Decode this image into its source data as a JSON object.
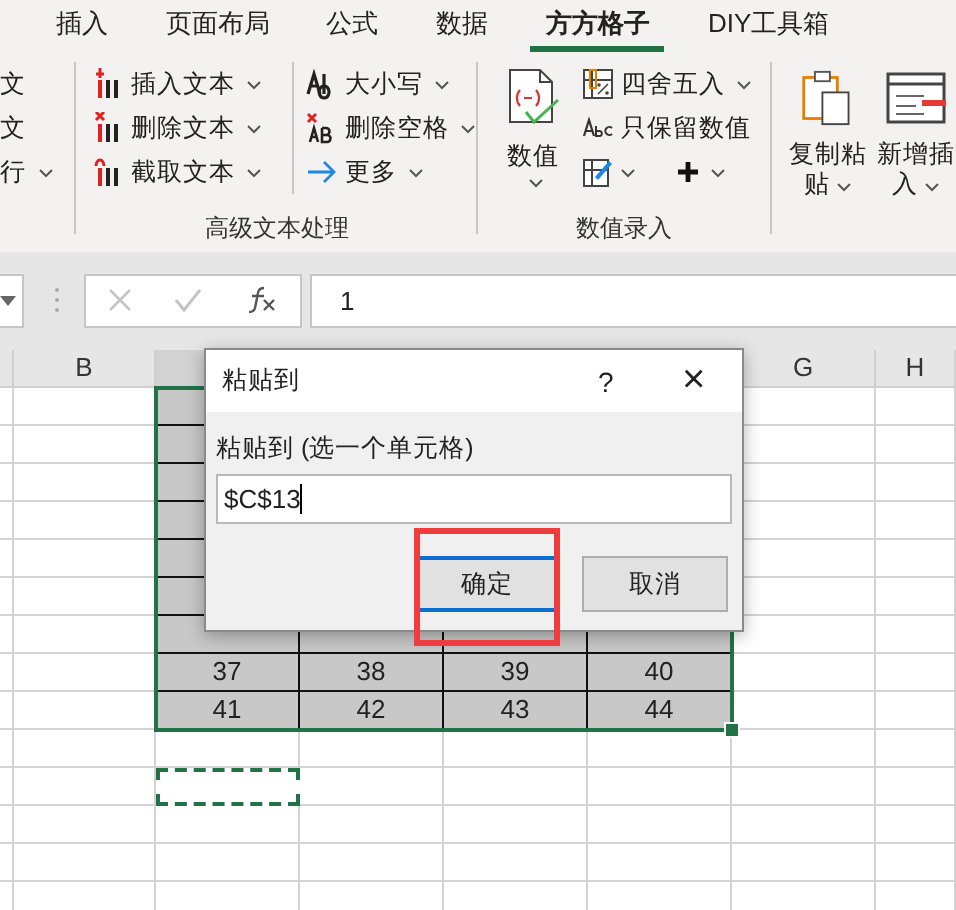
{
  "tabs": [
    {
      "label": "插入",
      "selected": false
    },
    {
      "label": "页面布局",
      "selected": false
    },
    {
      "label": "公式",
      "selected": false
    },
    {
      "label": "数据",
      "selected": false
    },
    {
      "label": "方方格子",
      "selected": true
    },
    {
      "label": "DIY工具箱",
      "selected": false
    }
  ],
  "ribbon": {
    "partial_group": {
      "items": [
        {
          "label": "文",
          "dropdown": false
        },
        {
          "label": "文",
          "dropdown": false
        },
        {
          "label": "行",
          "dropdown": true
        }
      ]
    },
    "text_group": {
      "label": "高级文本处理",
      "columns": [
        [
          {
            "label": "插入文本",
            "dropdown": true
          },
          {
            "label": "删除文本",
            "dropdown": true
          },
          {
            "label": "截取文本",
            "dropdown": true
          }
        ],
        [
          {
            "label": "大小写",
            "dropdown": true
          },
          {
            "label": "删除空格",
            "dropdown": true
          },
          {
            "label": "更多",
            "dropdown": true
          }
        ]
      ]
    },
    "number_group": {
      "label": "数值录入",
      "big_button": {
        "label": "数值",
        "dropdown": true
      },
      "items": [
        {
          "label": "四舍五入",
          "dropdown": true
        },
        {
          "label": "只保留数值",
          "dropdown": false
        }
      ],
      "icon_buttons": [
        {
          "dropdown": true
        },
        {
          "dropdown": true
        }
      ]
    },
    "right_buttons": [
      {
        "label": "复制粘贴",
        "dropdown": true
      },
      {
        "label": "新增插入",
        "dropdown": true
      }
    ]
  },
  "formula_bar": {
    "value": "1"
  },
  "columns": [
    "B",
    "G",
    "H"
  ],
  "table": {
    "rows": [
      [
        "37",
        "38",
        "39",
        "40"
      ],
      [
        "41",
        "42",
        "43",
        "44"
      ]
    ]
  },
  "dialog": {
    "title": "粘贴到",
    "help": "?",
    "close": "×",
    "prompt": "粘贴到 (选一个单元格)",
    "value": "$C$13",
    "buttons": [
      {
        "label": "确定",
        "default": true
      },
      {
        "label": "取消",
        "default": false
      }
    ]
  }
}
